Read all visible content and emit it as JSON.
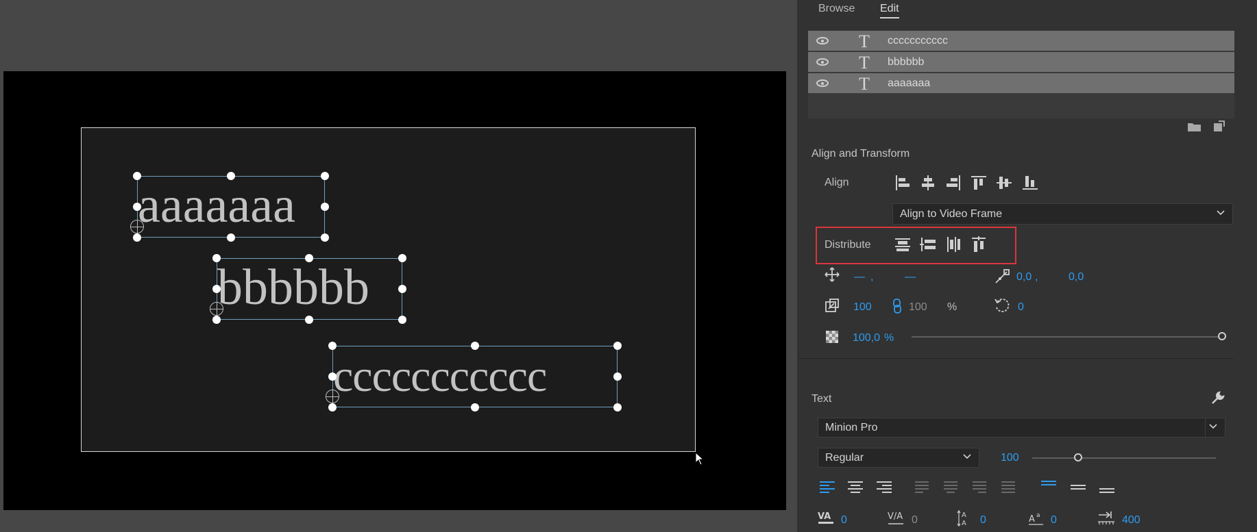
{
  "tabs": {
    "browse": "Browse",
    "edit": "Edit"
  },
  "layers": [
    {
      "name": "ccccccccccc",
      "icon": "text-layer-icon"
    },
    {
      "name": "bbbbbb",
      "icon": "text-layer-icon"
    },
    {
      "name": "aaaaaaa",
      "icon": "text-layer-icon"
    }
  ],
  "canvas": {
    "clip_a": "aaaaaaa",
    "clip_b": "bbbbbb",
    "clip_c": "ccccccccccc"
  },
  "align_transform": {
    "title": "Align and Transform",
    "align_label": "Align",
    "align_to": "Align to Video Frame",
    "distribute_label": "Distribute",
    "position_x": "—",
    "position_sep": ",",
    "position_y": "—",
    "anchor_x": "0,0",
    "anchor_sep": ",",
    "anchor_y": "0,0",
    "scale": "100",
    "scale_linked": "100",
    "scale_unit": "%",
    "rotation": "0",
    "opacity": "100,0",
    "opacity_unit": "%"
  },
  "text": {
    "title": "Text",
    "font": "Minion Pro",
    "style": "Regular",
    "size": "100",
    "kerning": "0",
    "tracking": "0",
    "leading": "0",
    "baseline": "0",
    "tab_width": "400"
  },
  "colors": {
    "accent": "#2e9cf0",
    "highlight": "#d9363e"
  }
}
